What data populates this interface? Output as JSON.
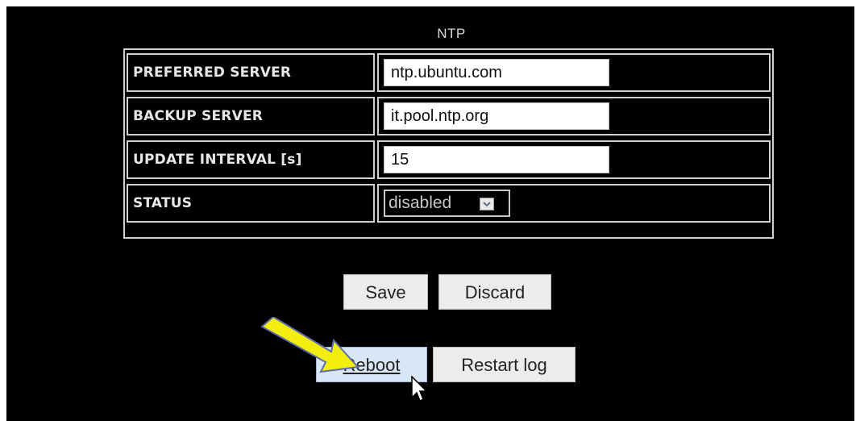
{
  "ntp": {
    "title": "NTP",
    "rows": [
      {
        "label": "PREFERRED SERVER",
        "value": "ntp.ubuntu.com"
      },
      {
        "label": "BACKUP SERVER",
        "value": "it.pool.ntp.org"
      },
      {
        "label": "UPDATE INTERVAL [s]",
        "value": "15"
      },
      {
        "label": "STATUS",
        "value": "disabled"
      }
    ]
  },
  "buttons": {
    "save": "Save",
    "discard": "Discard",
    "reboot": "Reboot",
    "restart_log": "Restart log"
  },
  "colors": {
    "background": "#000000",
    "highlight_arrow": "#f2ef10",
    "reboot_highlight": "#d9e6f6"
  },
  "icons": {
    "arrow": "arrow-pointer-icon",
    "cursor": "mouse-cursor-icon"
  }
}
